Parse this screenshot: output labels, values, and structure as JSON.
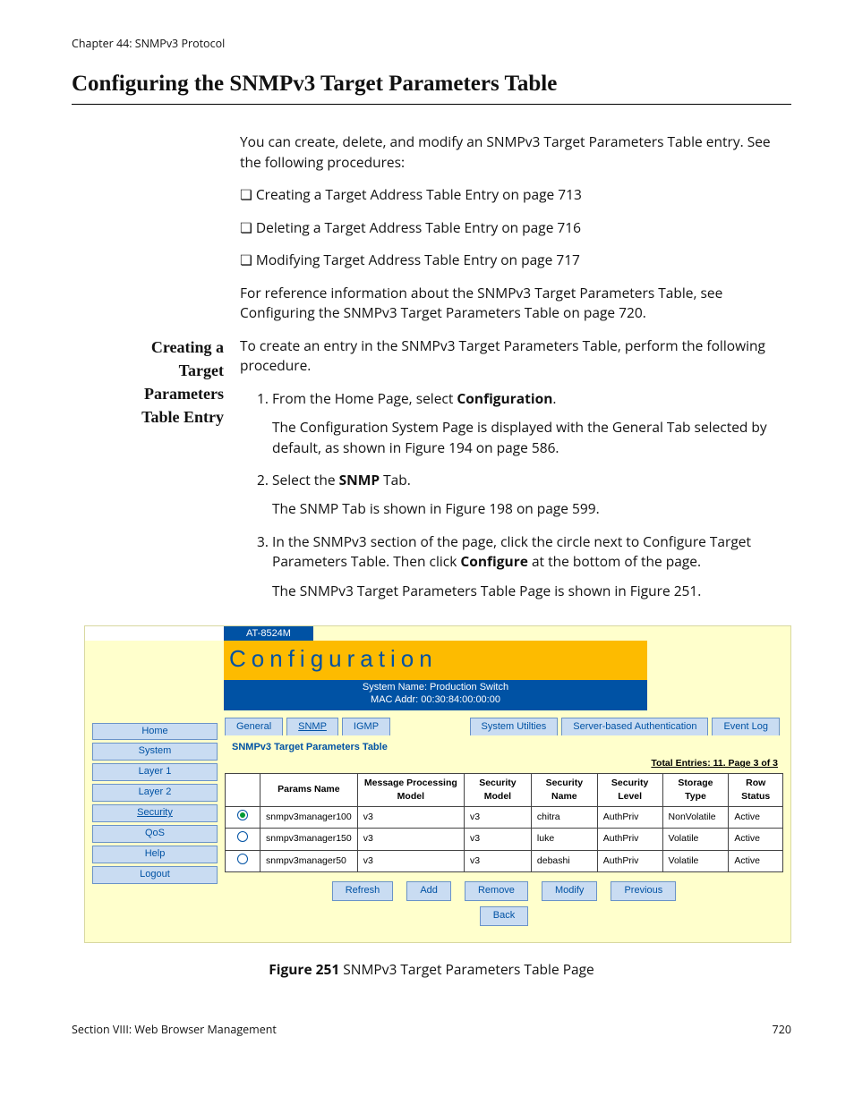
{
  "header": {
    "chapter": "Chapter 44: SNMPv3 Protocol"
  },
  "title": "Configuring the SNMPv3 Target Parameters Table",
  "intro": {
    "p1": "You can create, delete, and modify an SNMPv3 Target Parameters Table entry. See the following procedures:",
    "bullets": [
      "Creating a Target Address Table Entry on page 713",
      "Deleting a Target Address Table Entry on page 716",
      "Modifying Target Address Table Entry on page 717"
    ],
    "p2": "For reference information about the SNMPv3 Target Parameters Table, see Configuring the SNMPv3 Target Parameters Table on page 720."
  },
  "side_head": {
    "l1": "Creating a",
    "l2": "Target",
    "l3": "Parameters",
    "l4": "Table Entry"
  },
  "steps_intro": "To create an entry in the SNMPv3 Target Parameters Table, perform the following procedure.",
  "steps": {
    "s1a": "From the Home Page, select ",
    "s1b": "Configuration",
    "s1c": ".",
    "s1p": "The Configuration System Page is displayed with the General Tab selected by default, as shown in Figure 194 on page 586.",
    "s2a": "Select the ",
    "s2b": "SNMP",
    "s2c": " Tab.",
    "s2p": "The SNMP Tab is shown in Figure 198 on page 599.",
    "s3a": "In the SNMPv3 section of the page, click the circle next to Configure Target Parameters Table. Then click ",
    "s3b": "Configure",
    "s3c": " at the bottom of the page.",
    "s3p": "The SNMPv3 Target Parameters Table Page is shown in Figure 251."
  },
  "embed": {
    "device": "AT-8524M",
    "banner": "Configuration",
    "sys_line1": "System Name: Production Switch",
    "sys_line2": "MAC Addr: 00:30:84:00:00:00",
    "nav": [
      "Home",
      "System",
      "Layer 1",
      "Layer 2",
      "Security",
      "QoS",
      "Help",
      "Logout"
    ],
    "tabs_left": [
      "General",
      "SNMP",
      "IGMP"
    ],
    "tabs_right": [
      "System Utilties",
      "Server-based Authentication",
      "Event Log"
    ],
    "panel_title": "SNMPv3 Target Parameters Table",
    "panel_note": "Total Entries: 11. Page 3 of 3",
    "columns": [
      "",
      "Params Name",
      "Message Processing Model",
      "Security Model",
      "Security Name",
      "Security Level",
      "Storage Type",
      "Row Status"
    ],
    "rows": [
      {
        "sel": true,
        "cells": [
          "snmpv3manager100",
          "v3",
          "v3",
          "chitra",
          "AuthPriv",
          "NonVolatile",
          "Active"
        ]
      },
      {
        "sel": false,
        "cells": [
          "snmpv3manager150",
          "v3",
          "v3",
          "luke",
          "AuthPriv",
          "Volatile",
          "Active"
        ]
      },
      {
        "sel": false,
        "cells": [
          "snmpv3manager50",
          "v3",
          "v3",
          "debashi",
          "AuthPriv",
          "Volatile",
          "Active"
        ]
      }
    ],
    "buttons1": [
      "Refresh",
      "Add",
      "Remove",
      "Modify",
      "Previous"
    ],
    "buttons2": [
      "Back"
    ]
  },
  "figure": {
    "label": "Figure 251",
    "caption": "  SNMPv3 Target Parameters Table Page"
  },
  "footer": {
    "left": "Section VIII: Web Browser Management",
    "right": "720"
  }
}
